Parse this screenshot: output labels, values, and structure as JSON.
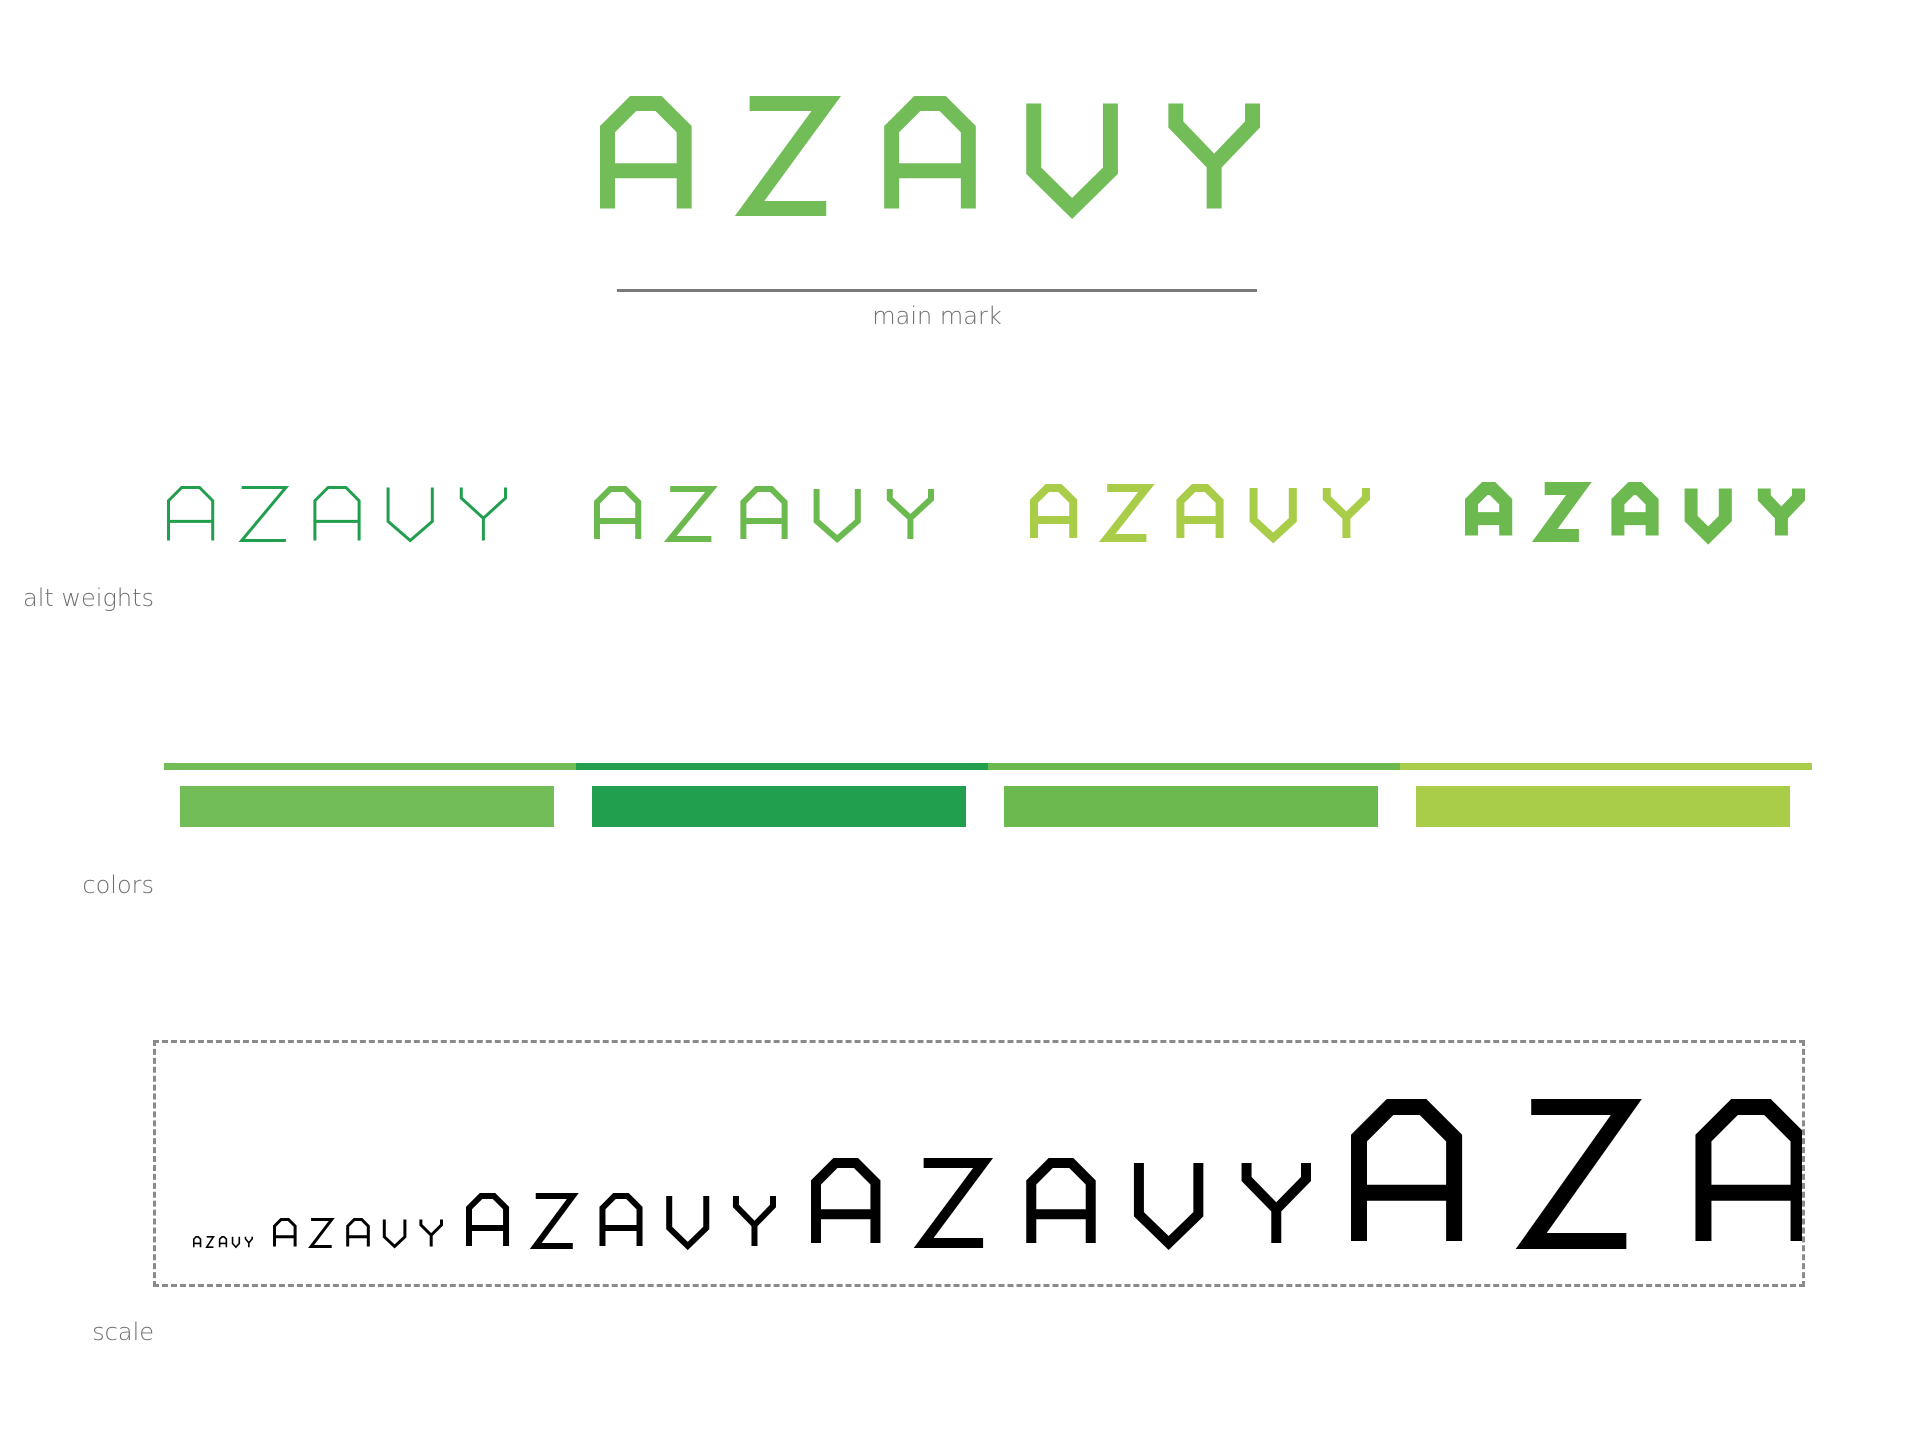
{
  "brand": {
    "wordmark": [
      "A",
      "Z",
      "A",
      "V",
      "Y"
    ],
    "wordmark_text": "AZAVY"
  },
  "labels": {
    "main_mark": "main mark",
    "alt_weights": "alt weights",
    "colors": "colors",
    "scale": "scale"
  },
  "palette": {
    "main": "#72bd58",
    "dark_green": "#229e4f",
    "mid_green": "#6cb94f",
    "lime": "#a9cd49",
    "rule_gray": "#7a7a7a",
    "scale_black": "#000000"
  },
  "colors_section": {
    "swatches": [
      "#72bd58",
      "#229e4f",
      "#6cb94f",
      "#a9cd49"
    ]
  },
  "alt_weights": [
    {
      "weight": "thin",
      "color": "#229e4f"
    },
    {
      "weight": "light",
      "color": "#6cb94f"
    },
    {
      "weight": "regular",
      "color": "#a9cd49"
    },
    {
      "weight": "bold",
      "color": "#6cb94f"
    }
  ]
}
